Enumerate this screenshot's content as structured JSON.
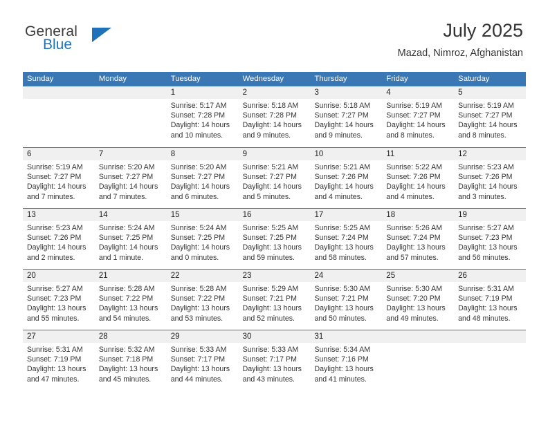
{
  "brand": {
    "line1": "General",
    "line2": "Blue",
    "triangle_icon": "triangle-icon",
    "color_dark": "#3b3b3b",
    "color_blue": "#1f72b8"
  },
  "header": {
    "title": "July 2025",
    "location": "Mazad, Nimroz, Afghanistan"
  },
  "theme": {
    "header_blue": "#3a78b5",
    "day_band_gray": "#f0f0f0",
    "text": "#333333"
  },
  "calendar": {
    "weekdays": [
      "Sunday",
      "Monday",
      "Tuesday",
      "Wednesday",
      "Thursday",
      "Friday",
      "Saturday"
    ],
    "weeks": [
      [
        {
          "day": "",
          "empty": true
        },
        {
          "day": "",
          "empty": true
        },
        {
          "day": "1",
          "sunrise": "Sunrise: 5:17 AM",
          "sunset": "Sunset: 7:28 PM",
          "daylight": "Daylight: 14 hours and 10 minutes."
        },
        {
          "day": "2",
          "sunrise": "Sunrise: 5:18 AM",
          "sunset": "Sunset: 7:28 PM",
          "daylight": "Daylight: 14 hours and 9 minutes."
        },
        {
          "day": "3",
          "sunrise": "Sunrise: 5:18 AM",
          "sunset": "Sunset: 7:27 PM",
          "daylight": "Daylight: 14 hours and 9 minutes."
        },
        {
          "day": "4",
          "sunrise": "Sunrise: 5:19 AM",
          "sunset": "Sunset: 7:27 PM",
          "daylight": "Daylight: 14 hours and 8 minutes."
        },
        {
          "day": "5",
          "sunrise": "Sunrise: 5:19 AM",
          "sunset": "Sunset: 7:27 PM",
          "daylight": "Daylight: 14 hours and 8 minutes."
        }
      ],
      [
        {
          "day": "6",
          "sunrise": "Sunrise: 5:19 AM",
          "sunset": "Sunset: 7:27 PM",
          "daylight": "Daylight: 14 hours and 7 minutes."
        },
        {
          "day": "7",
          "sunrise": "Sunrise: 5:20 AM",
          "sunset": "Sunset: 7:27 PM",
          "daylight": "Daylight: 14 hours and 7 minutes."
        },
        {
          "day": "8",
          "sunrise": "Sunrise: 5:20 AM",
          "sunset": "Sunset: 7:27 PM",
          "daylight": "Daylight: 14 hours and 6 minutes."
        },
        {
          "day": "9",
          "sunrise": "Sunrise: 5:21 AM",
          "sunset": "Sunset: 7:27 PM",
          "daylight": "Daylight: 14 hours and 5 minutes."
        },
        {
          "day": "10",
          "sunrise": "Sunrise: 5:21 AM",
          "sunset": "Sunset: 7:26 PM",
          "daylight": "Daylight: 14 hours and 4 minutes."
        },
        {
          "day": "11",
          "sunrise": "Sunrise: 5:22 AM",
          "sunset": "Sunset: 7:26 PM",
          "daylight": "Daylight: 14 hours and 4 minutes."
        },
        {
          "day": "12",
          "sunrise": "Sunrise: 5:23 AM",
          "sunset": "Sunset: 7:26 PM",
          "daylight": "Daylight: 14 hours and 3 minutes."
        }
      ],
      [
        {
          "day": "13",
          "sunrise": "Sunrise: 5:23 AM",
          "sunset": "Sunset: 7:26 PM",
          "daylight": "Daylight: 14 hours and 2 minutes."
        },
        {
          "day": "14",
          "sunrise": "Sunrise: 5:24 AM",
          "sunset": "Sunset: 7:25 PM",
          "daylight": "Daylight: 14 hours and 1 minute."
        },
        {
          "day": "15",
          "sunrise": "Sunrise: 5:24 AM",
          "sunset": "Sunset: 7:25 PM",
          "daylight": "Daylight: 14 hours and 0 minutes."
        },
        {
          "day": "16",
          "sunrise": "Sunrise: 5:25 AM",
          "sunset": "Sunset: 7:25 PM",
          "daylight": "Daylight: 13 hours and 59 minutes."
        },
        {
          "day": "17",
          "sunrise": "Sunrise: 5:25 AM",
          "sunset": "Sunset: 7:24 PM",
          "daylight": "Daylight: 13 hours and 58 minutes."
        },
        {
          "day": "18",
          "sunrise": "Sunrise: 5:26 AM",
          "sunset": "Sunset: 7:24 PM",
          "daylight": "Daylight: 13 hours and 57 minutes."
        },
        {
          "day": "19",
          "sunrise": "Sunrise: 5:27 AM",
          "sunset": "Sunset: 7:23 PM",
          "daylight": "Daylight: 13 hours and 56 minutes."
        }
      ],
      [
        {
          "day": "20",
          "sunrise": "Sunrise: 5:27 AM",
          "sunset": "Sunset: 7:23 PM",
          "daylight": "Daylight: 13 hours and 55 minutes."
        },
        {
          "day": "21",
          "sunrise": "Sunrise: 5:28 AM",
          "sunset": "Sunset: 7:22 PM",
          "daylight": "Daylight: 13 hours and 54 minutes."
        },
        {
          "day": "22",
          "sunrise": "Sunrise: 5:28 AM",
          "sunset": "Sunset: 7:22 PM",
          "daylight": "Daylight: 13 hours and 53 minutes."
        },
        {
          "day": "23",
          "sunrise": "Sunrise: 5:29 AM",
          "sunset": "Sunset: 7:21 PM",
          "daylight": "Daylight: 13 hours and 52 minutes."
        },
        {
          "day": "24",
          "sunrise": "Sunrise: 5:30 AM",
          "sunset": "Sunset: 7:21 PM",
          "daylight": "Daylight: 13 hours and 50 minutes."
        },
        {
          "day": "25",
          "sunrise": "Sunrise: 5:30 AM",
          "sunset": "Sunset: 7:20 PM",
          "daylight": "Daylight: 13 hours and 49 minutes."
        },
        {
          "day": "26",
          "sunrise": "Sunrise: 5:31 AM",
          "sunset": "Sunset: 7:19 PM",
          "daylight": "Daylight: 13 hours and 48 minutes."
        }
      ],
      [
        {
          "day": "27",
          "sunrise": "Sunrise: 5:31 AM",
          "sunset": "Sunset: 7:19 PM",
          "daylight": "Daylight: 13 hours and 47 minutes."
        },
        {
          "day": "28",
          "sunrise": "Sunrise: 5:32 AM",
          "sunset": "Sunset: 7:18 PM",
          "daylight": "Daylight: 13 hours and 45 minutes."
        },
        {
          "day": "29",
          "sunrise": "Sunrise: 5:33 AM",
          "sunset": "Sunset: 7:17 PM",
          "daylight": "Daylight: 13 hours and 44 minutes."
        },
        {
          "day": "30",
          "sunrise": "Sunrise: 5:33 AM",
          "sunset": "Sunset: 7:17 PM",
          "daylight": "Daylight: 13 hours and 43 minutes."
        },
        {
          "day": "31",
          "sunrise": "Sunrise: 5:34 AM",
          "sunset": "Sunset: 7:16 PM",
          "daylight": "Daylight: 13 hours and 41 minutes."
        },
        {
          "day": "",
          "empty": true
        },
        {
          "day": "",
          "empty": true
        }
      ]
    ]
  }
}
